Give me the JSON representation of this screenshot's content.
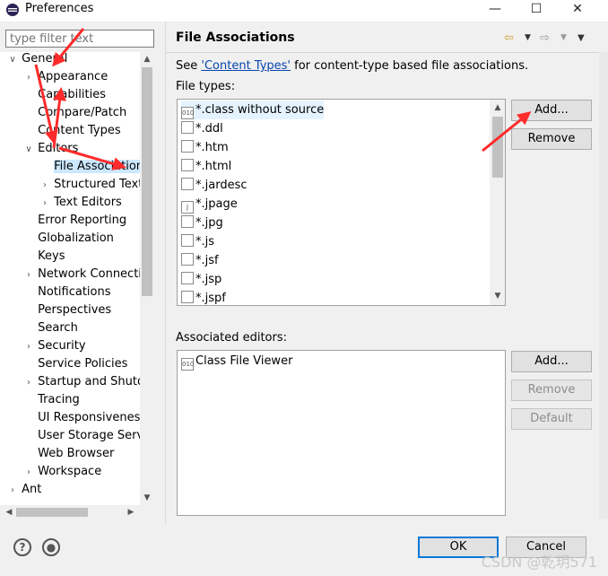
{
  "window": {
    "title": "Preferences",
    "controls": [
      "—",
      "☐",
      "✕"
    ]
  },
  "filter": {
    "placeholder": "type filter text"
  },
  "tree": {
    "items": [
      {
        "label": "General",
        "level": 0,
        "chevron": "v"
      },
      {
        "label": "Appearance",
        "level": 1,
        "chevron": ">"
      },
      {
        "label": "Capabilities",
        "level": 1,
        "chevron": ""
      },
      {
        "label": "Compare/Patch",
        "level": 1,
        "chevron": ""
      },
      {
        "label": "Content Types",
        "level": 1,
        "chevron": ""
      },
      {
        "label": "Editors",
        "level": 1,
        "chevron": "v"
      },
      {
        "label": "File Associations",
        "level": 2,
        "chevron": "",
        "selected": true
      },
      {
        "label": "Structured Text Editors",
        "level": 2,
        "chevron": ">"
      },
      {
        "label": "Text Editors",
        "level": 2,
        "chevron": ">"
      },
      {
        "label": "Error Reporting",
        "level": 1,
        "chevron": ""
      },
      {
        "label": "Globalization",
        "level": 1,
        "chevron": ""
      },
      {
        "label": "Keys",
        "level": 1,
        "chevron": ""
      },
      {
        "label": "Network Connections",
        "level": 1,
        "chevron": ">"
      },
      {
        "label": "Notifications",
        "level": 1,
        "chevron": ""
      },
      {
        "label": "Perspectives",
        "level": 1,
        "chevron": ""
      },
      {
        "label": "Search",
        "level": 1,
        "chevron": ""
      },
      {
        "label": "Security",
        "level": 1,
        "chevron": ">"
      },
      {
        "label": "Service Policies",
        "level": 1,
        "chevron": ""
      },
      {
        "label": "Startup and Shutdown",
        "level": 1,
        "chevron": ">"
      },
      {
        "label": "Tracing",
        "level": 1,
        "chevron": ""
      },
      {
        "label": "UI Responsiveness Monitoring",
        "level": 1,
        "chevron": ""
      },
      {
        "label": "User Storage Service",
        "level": 1,
        "chevron": ""
      },
      {
        "label": "Web Browser",
        "level": 1,
        "chevron": ""
      },
      {
        "label": "Workspace",
        "level": 1,
        "chevron": ">"
      },
      {
        "label": "Ant",
        "level": 0,
        "chevron": ">"
      }
    ]
  },
  "page": {
    "title": "File Associations",
    "see_prefix": "See ",
    "see_link": "'Content Types'",
    "see_suffix": " for content-type based file associations.",
    "file_types_label": "File types:",
    "associated_editors_label": "Associated editors:"
  },
  "file_types": [
    {
      "name": "*.class without source",
      "icon": "class-file-icon",
      "icon_text": "010",
      "selected": true
    },
    {
      "name": "*.ddl",
      "icon": "ddl-file-icon",
      "icon_text": ""
    },
    {
      "name": "*.htm",
      "icon": "html-file-icon",
      "icon_text": ""
    },
    {
      "name": "*.html",
      "icon": "html-file-icon",
      "icon_text": ""
    },
    {
      "name": "*.jardesc",
      "icon": "jardesc-file-icon",
      "icon_text": ""
    },
    {
      "name": "*.jpage",
      "icon": "jpage-file-icon",
      "icon_text": "J"
    },
    {
      "name": "*.jpg",
      "icon": "image-file-icon",
      "icon_text": ""
    },
    {
      "name": "*.js",
      "icon": "js-file-icon",
      "icon_text": ""
    },
    {
      "name": "*.jsf",
      "icon": "jsf-file-icon",
      "icon_text": ""
    },
    {
      "name": "*.jsp",
      "icon": "jsp-file-icon",
      "icon_text": ""
    },
    {
      "name": "*.jspf",
      "icon": "jspf-file-icon",
      "icon_text": ""
    }
  ],
  "associated_editors": [
    {
      "name": "Class File Viewer",
      "icon": "class-file-icon",
      "icon_text": "010"
    }
  ],
  "buttons": {
    "add_type": "Add...",
    "remove_type": "Remove",
    "add_editor": "Add...",
    "remove_editor": "Remove",
    "default_editor": "Default",
    "ok": "OK",
    "cancel": "Cancel"
  },
  "bottom": {
    "help_icon": "?",
    "watermark": "CSDN @乾玥571"
  },
  "colors": {
    "selection": "#cce8ff",
    "link": "#0645ad",
    "annotation_arrow": "#ff2b2b",
    "primary_border": "#0078d7"
  }
}
